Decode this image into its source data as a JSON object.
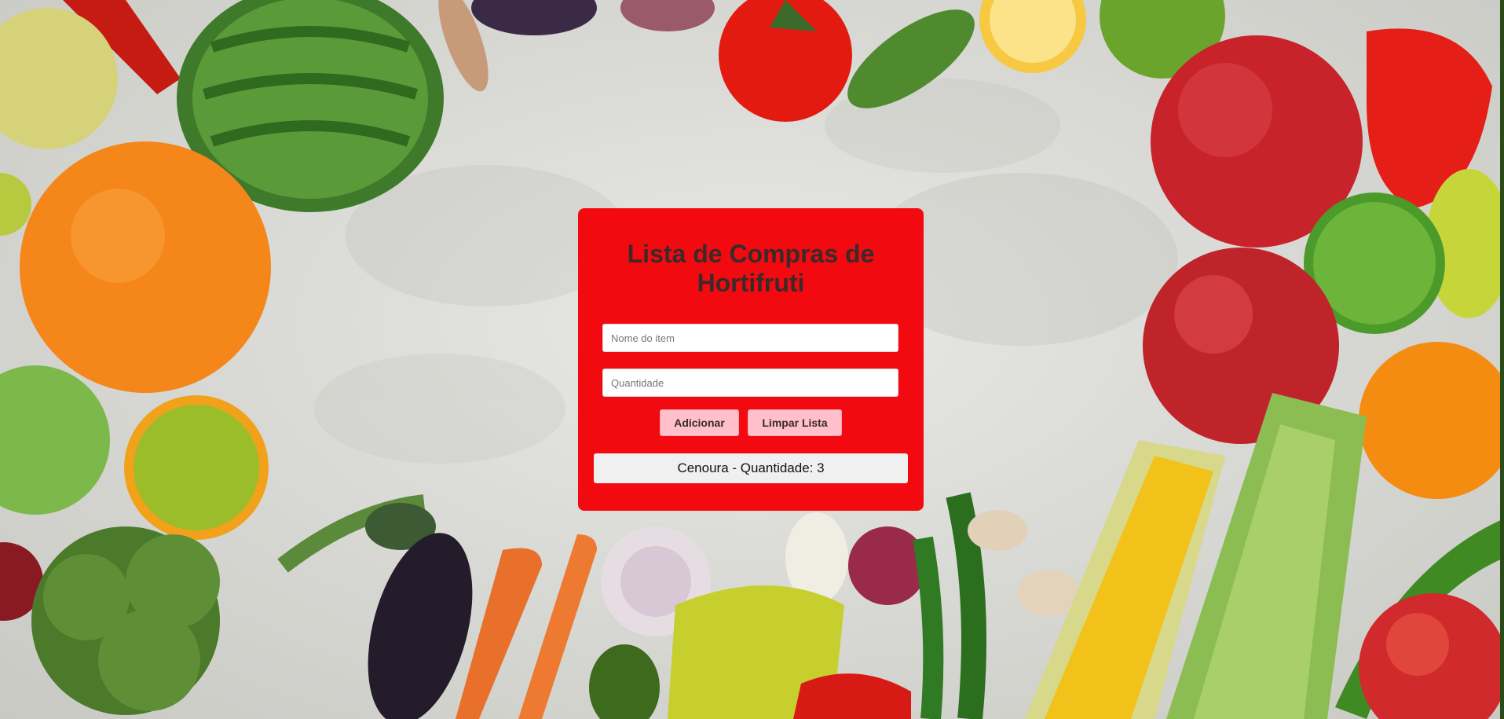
{
  "app": {
    "title": "Lista de Compras de Hortifruti"
  },
  "form": {
    "item_name": {
      "value": "",
      "placeholder": "Nome do item"
    },
    "quantity": {
      "value": "",
      "placeholder": "Quantidade"
    },
    "add_label": "Adicionar",
    "clear_label": "Limpar Lista"
  },
  "list": {
    "items": [
      {
        "text": "Cenoura - Quantidade: 3"
      }
    ]
  },
  "colors": {
    "card": "#f20a10",
    "button": "#ffc0cb",
    "title_text": "#3a2a2a",
    "item_bg": "#f0f0f0"
  },
  "background": {
    "image": "vegetables-and-fruits-photo"
  }
}
